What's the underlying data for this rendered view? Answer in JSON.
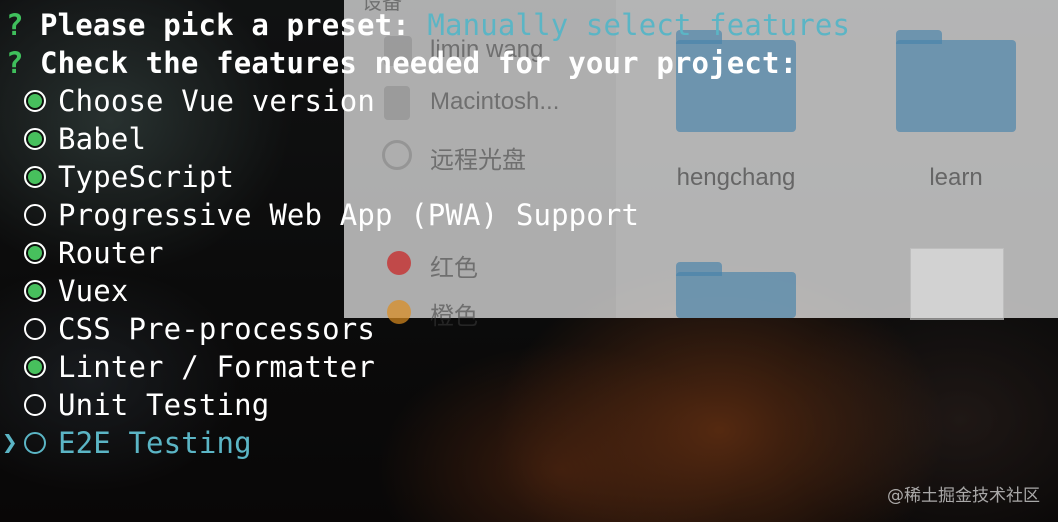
{
  "colors": {
    "prompt": "#3fbf5c",
    "answer": "#5bb5c5",
    "checked": "#47c05d",
    "text": "#ffffff"
  },
  "finder": {
    "sidebar": {
      "section_header": "设备",
      "items": [
        {
          "label": "limin wang",
          "icon": "computer-icon"
        },
        {
          "label": "Macintosh...",
          "icon": "hard-drive-icon"
        },
        {
          "label": "远程光盘",
          "icon": "disc-icon"
        },
        {
          "label": "红色",
          "icon": "red-tag-icon"
        },
        {
          "label": "橙色",
          "icon": "orange-tag-icon"
        }
      ]
    },
    "folders": [
      {
        "label": "hengchang"
      },
      {
        "label": "learn"
      }
    ]
  },
  "terminal": {
    "prompt_symbol": "?",
    "question1": "Please pick a preset: ",
    "answer1": "Manually select features",
    "question2": "Check the features needed for your project:",
    "pointer": "❯",
    "options": [
      {
        "label": "Choose Vue version",
        "checked": true
      },
      {
        "label": "Babel",
        "checked": true
      },
      {
        "label": "TypeScript",
        "checked": true
      },
      {
        "label": "Progressive Web App (PWA) Support",
        "checked": false
      },
      {
        "label": "Router",
        "checked": true
      },
      {
        "label": "Vuex",
        "checked": true
      },
      {
        "label": "CSS Pre-processors",
        "checked": false
      },
      {
        "label": "Linter / Formatter",
        "checked": true
      },
      {
        "label": "Unit Testing",
        "checked": false
      },
      {
        "label": "E2E Testing",
        "checked": false,
        "cursor": true
      }
    ]
  },
  "watermark": "@稀土掘金技术社区"
}
